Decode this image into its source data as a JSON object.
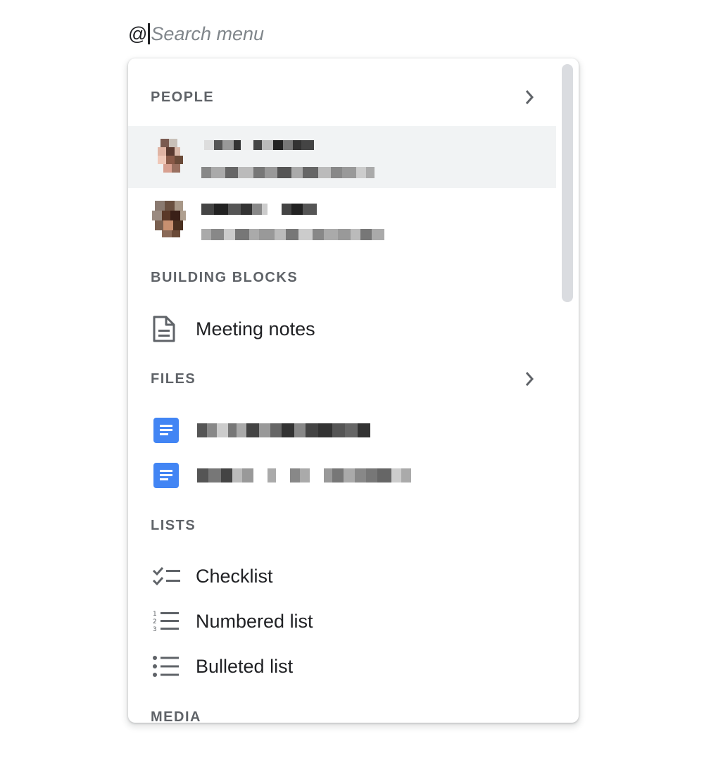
{
  "search": {
    "prefix": "@",
    "placeholder": "Search menu"
  },
  "sections": {
    "people": {
      "title": "PEOPLE"
    },
    "building_blocks": {
      "title": "BUILDING BLOCKS",
      "items": [
        {
          "label": "Meeting notes",
          "icon": "document-icon"
        }
      ]
    },
    "files": {
      "title": "FILES"
    },
    "lists": {
      "title": "LISTS",
      "items": [
        {
          "label": "Checklist",
          "icon": "checklist-icon"
        },
        {
          "label": "Numbered list",
          "icon": "numbered-list-icon"
        },
        {
          "label": "Bulleted list",
          "icon": "bulleted-list-icon"
        }
      ]
    },
    "media": {
      "title": "MEDIA"
    }
  },
  "colors": {
    "doc_blue": "#4285f4",
    "selected_bg": "#f1f3f4",
    "header_gray": "#5f6368"
  }
}
